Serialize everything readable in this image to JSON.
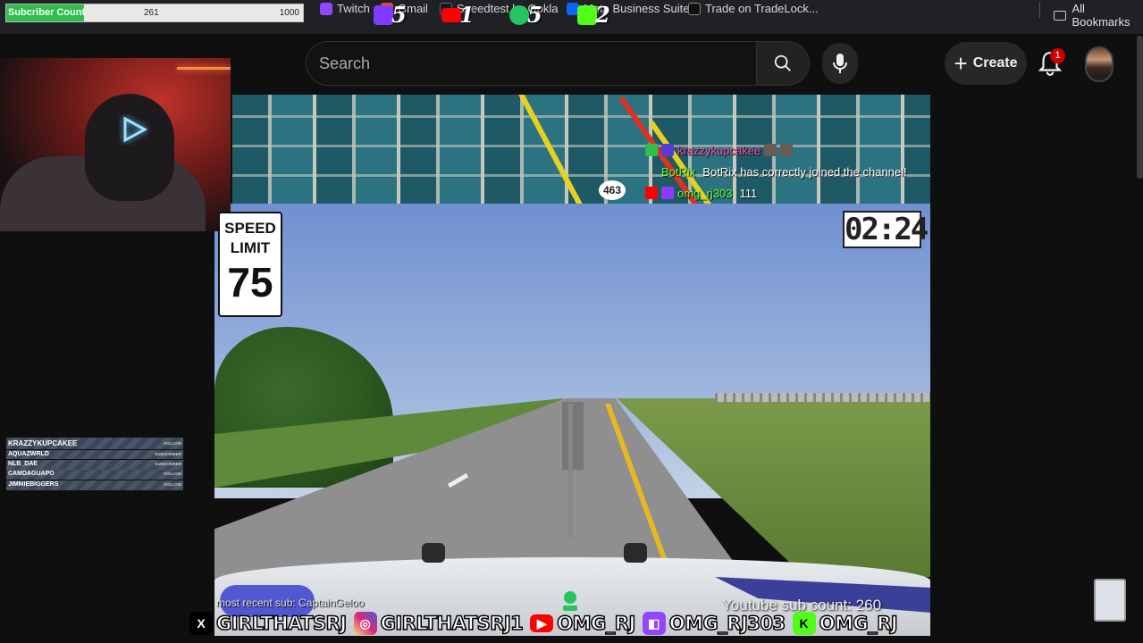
{
  "subscriber_counter": {
    "label": "Subcriber Count",
    "current": "261",
    "max": "1000",
    "progress": 0.261,
    "fill_color": "#2fbe49"
  },
  "bookmarks": [
    {
      "label": "Twitch",
      "icon": "twitch-icon",
      "color": "#9146ff"
    },
    {
      "label": "Gmail",
      "icon": "gmail-icon",
      "color": "#ea4335"
    },
    {
      "label": "Speedtest by Ookla",
      "icon": "speedtest-icon",
      "color": "#141526"
    },
    {
      "label": "Meta Business Suite",
      "icon": "meta-icon",
      "color": "#0866ff"
    },
    {
      "label": "Trade on TradeLock...",
      "icon": "tradelocker-icon",
      "color": "#111111"
    }
  ],
  "platform_counters": [
    {
      "icon": "twitch-counter-icon",
      "value": "5",
      "color": "#7d3cff"
    },
    {
      "icon": "youtube-counter-icon",
      "value": "1",
      "color": "#ff0000"
    },
    {
      "icon": "tango-counter-icon",
      "value": "5",
      "color": "#24c460"
    },
    {
      "icon": "kick-counter-icon",
      "value": "2",
      "color": "#53fc18"
    }
  ],
  "all_bookmarks": "All Bookmarks",
  "youtube": {
    "search_placeholder": "Search",
    "create_label": "Create",
    "notification_count": "1"
  },
  "video": {
    "speed_sign_title": "SPEED LIMIT",
    "speed_value": "75",
    "timer": "02:24",
    "route_number": "463"
  },
  "chat": [
    {
      "user": "krazzykupcakee",
      "message": "",
      "user_color": "#ff4aa8"
    },
    {
      "user": "BotRix",
      "message": "BotRix has correctly joined the channel!",
      "user_color": "#6cff3a"
    },
    {
      "user": "omg_rj303",
      "message": "111",
      "user_color": "#6cff3a"
    }
  ],
  "recent_events": [
    {
      "name": "KRAZZYKUPCAKEE",
      "type": "FOLLOW"
    },
    {
      "name": "AQUAZWRLD",
      "type": "SUBSCRIBER"
    },
    {
      "name": "NLB_DAE",
      "type": "SUBSCRIBER"
    },
    {
      "name": "CAMDAGUAPO",
      "type": "FOLLOW"
    },
    {
      "name": "JIMMIEBIGGERS",
      "type": "FOLLOW"
    }
  ],
  "cheers_text": "most recent sub: CaptainGeloo",
  "youtube_sub_count": "Youtube sub count: 260",
  "socials": [
    {
      "icon": "x-icon",
      "handle": "GIRLTHATSRJ",
      "color": "#000000"
    },
    {
      "icon": "instagram-icon",
      "handle": "GIRLTHATSRJ1",
      "color": "#d62976"
    },
    {
      "icon": "youtube-icon",
      "handle": "OMG_RJ",
      "color": "#ff0000"
    },
    {
      "icon": "twitch-icon",
      "handle": "OMG_RJ303",
      "color": "#9146ff"
    },
    {
      "icon": "kick-icon",
      "handle": "OMG_RJ",
      "color": "#53fc18"
    }
  ]
}
